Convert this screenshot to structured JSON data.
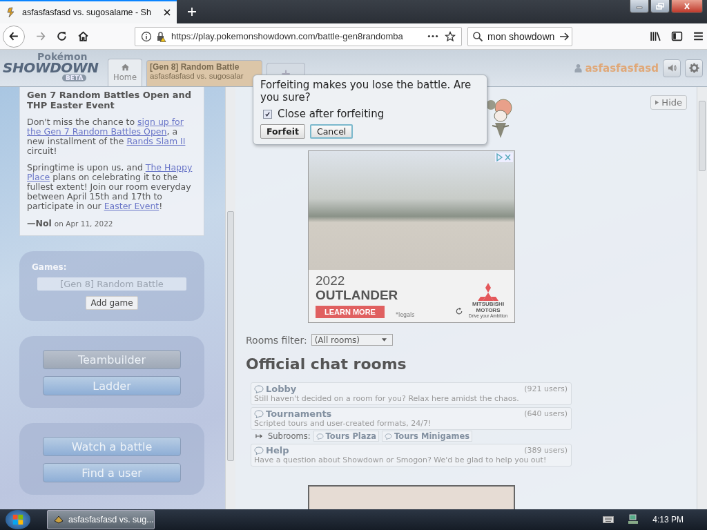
{
  "browser": {
    "tab_title": "asfasfasfasd vs. sugosalame - Sh",
    "url": "https://play.pokemonshowdown.com/battle-gen8randomba",
    "search": "mon showdown"
  },
  "header": {
    "logo_top": "Pokémon",
    "logo": "SHOWDOWN",
    "logo_badge": "BETA",
    "username": "asfasfasfasd",
    "tabs": [
      {
        "kind": "home",
        "label": "Home",
        "selected": true
      },
      {
        "kind": "battle",
        "label": "[Gen 8] Random Battle",
        "sublabel": "asfasfasfasd vs. sugosalar",
        "selected": false
      },
      {
        "kind": "new",
        "label": "+",
        "selected": false
      }
    ]
  },
  "news": {
    "title": "Gen 7 Random Battles Open and THP Easter Event",
    "paragraphs": [
      [
        {
          "text": "Don't miss the chance to "
        },
        {
          "link": "sign up for"
        },
        {
          "link": "the Gen 7 Random Battles Open"
        },
        {
          "text": ", a new installment of the "
        },
        {
          "link": "Rands Slam II"
        },
        {
          "text": " circuit!"
        }
      ],
      [
        {
          "text": "Springtime is upon us, and "
        },
        {
          "link": "The Happy"
        },
        {
          "link": "Place"
        },
        {
          "text": " plans on celebrating it to the fullest extent! Join our room everyday between April 15th and 17th to participate in our "
        },
        {
          "link": "Easter Event"
        },
        {
          "text": "!"
        }
      ]
    ],
    "author": "—Nol",
    "date": "on Apr 11, 2022"
  },
  "games": {
    "label": "Games:",
    "current": "[Gen 8] Random Battle",
    "add": "Add game"
  },
  "button_groups": [
    {
      "buttons": [
        {
          "label": "Teambuilder",
          "highlighted": true
        },
        {
          "label": "Ladder",
          "highlighted": false
        }
      ]
    },
    {
      "buttons": [
        {
          "label": "Watch a battle",
          "highlighted": false
        },
        {
          "label": "Find a user",
          "highlighted": false
        }
      ]
    }
  ],
  "hide": "Hide",
  "dialog": {
    "message": "Forfeiting makes you lose the battle. Are you sure?",
    "checkbox": {
      "label": "Close after forfeiting",
      "checked": true
    },
    "buttons": [
      {
        "label": "Forfeit",
        "kind": "primary"
      },
      {
        "label": "Cancel",
        "kind": "focused"
      }
    ]
  },
  "ad": {
    "year": "2022",
    "model": "OUTLANDER",
    "cta": "LEARN MORE",
    "legal": "*legals",
    "brand": "MITSUBISHI MOTORS",
    "tagline": "Drive your Ambition"
  },
  "filter": {
    "label": "Rooms filter:",
    "value": "(All rooms)"
  },
  "heading": "Official chat rooms",
  "rooms": [
    {
      "name": "Lobby",
      "users": "(921 users)",
      "desc": "Still haven't decided on a room for you? Relax here amidst the chaos."
    },
    {
      "name": "Tournaments",
      "users": "(640 users)",
      "desc": "Scripted tours and user-created formats, 24/7!",
      "subrooms_label": "Subrooms:",
      "subrooms": [
        "Tours Plaza",
        "Tours Minigames"
      ]
    },
    {
      "name": "Help",
      "users": "(389 users)",
      "desc": "Have a question about Showdown or Smogon? We'd be glad to help you out!"
    }
  ],
  "taskbar": {
    "window": "asfasfasfasd vs. sug...",
    "time": "4:13 PM"
  }
}
